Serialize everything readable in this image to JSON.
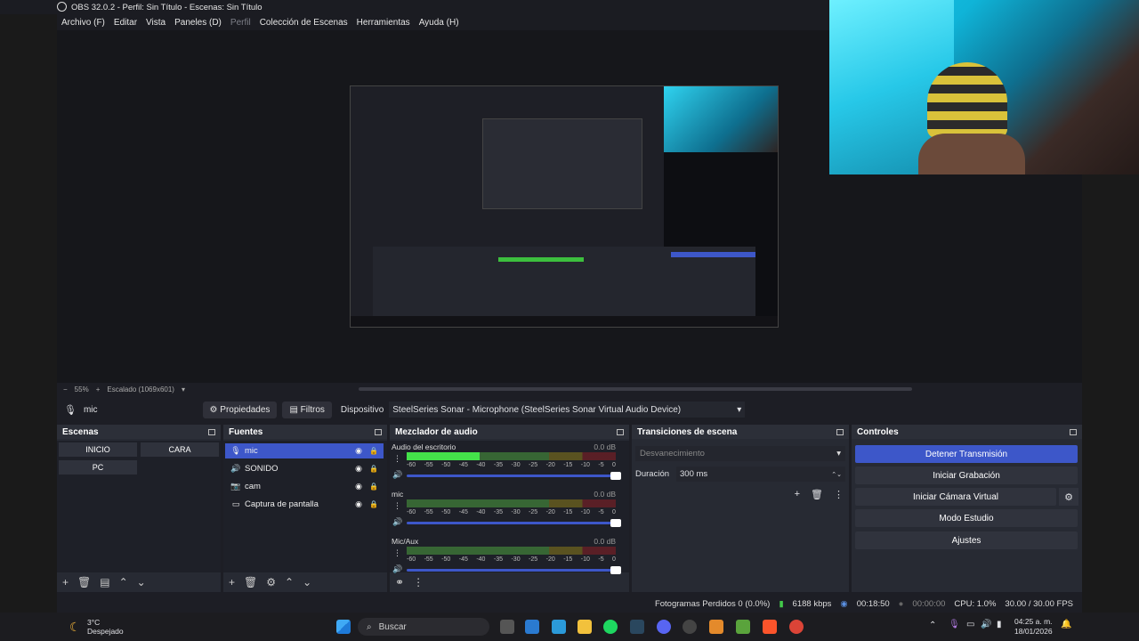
{
  "window": {
    "title": "OBS 32.0.2 - Perfil: Sin Título - Escenas: Sin Título"
  },
  "menu": [
    "Archivo (F)",
    "Editar",
    "Vista",
    "Paneles (D)",
    "Perfil",
    "Colección de Escenas",
    "Herramientas",
    "Ayuda (H)"
  ],
  "zoom": {
    "minus": "−",
    "level": "55%",
    "plus": "+",
    "scale": "Escalado (1069x601)"
  },
  "properties_bar": {
    "source": "mic",
    "properties_label": "Propiedades",
    "filters_label": "Filtros",
    "device_label": "Dispositivo",
    "device_value": "SteelSeries Sonar - Microphone (SteelSeries Sonar Virtual Audio Device)"
  },
  "scenes": {
    "title": "Escenas",
    "items": [
      "INICIO",
      "CARA",
      "PC"
    ]
  },
  "sources": {
    "title": "Fuentes",
    "items": [
      {
        "name": "mic",
        "icon": "mic-icon"
      },
      {
        "name": "SONIDO",
        "icon": "speaker-icon"
      },
      {
        "name": "cam",
        "icon": "camera-icon"
      },
      {
        "name": "Captura de pantalla",
        "icon": "monitor-icon"
      }
    ]
  },
  "mixer": {
    "title": "Mezclador de audio",
    "ticks": [
      "-60",
      "-55",
      "-50",
      "-45",
      "-40",
      "-35",
      "-30",
      "-25",
      "-20",
      "-15",
      "-10",
      "-5",
      "0"
    ],
    "channels": [
      {
        "name": "Audio del escritorio",
        "db": "0.0 dB",
        "level": 0.35
      },
      {
        "name": "mic",
        "db": "0.0 dB",
        "level": 0
      },
      {
        "name": "Mic/Aux",
        "db": "0.0 dB",
        "level": 0
      }
    ]
  },
  "transitions": {
    "title": "Transiciones de escena",
    "selected": "Desvanecimiento",
    "duration_label": "Duración",
    "duration_value": "300 ms"
  },
  "controls": {
    "title": "Controles",
    "buttons": [
      "Detener Transmisión",
      "Iniciar Grabación",
      "Iniciar Cámara Virtual",
      "Modo Estudio",
      "Ajustes"
    ]
  },
  "status": {
    "dropped": "Fotogramas Perdidos 0 (0.0%)",
    "bitrate": "6188 kbps",
    "stream_time": "00:18:50",
    "rec_time": "00:00:00",
    "cpu": "CPU: 1.0%",
    "fps": "30.00 / 30.00 FPS"
  },
  "taskbar": {
    "weather_temp": "3°C",
    "weather_desc": "Despejado",
    "search": "Buscar",
    "time": "04:25 a. m.",
    "date": "18/01/2026"
  },
  "colors": {
    "accent": "#3d57c9",
    "bg": "#1d1e25",
    "panel": "#272a33"
  }
}
